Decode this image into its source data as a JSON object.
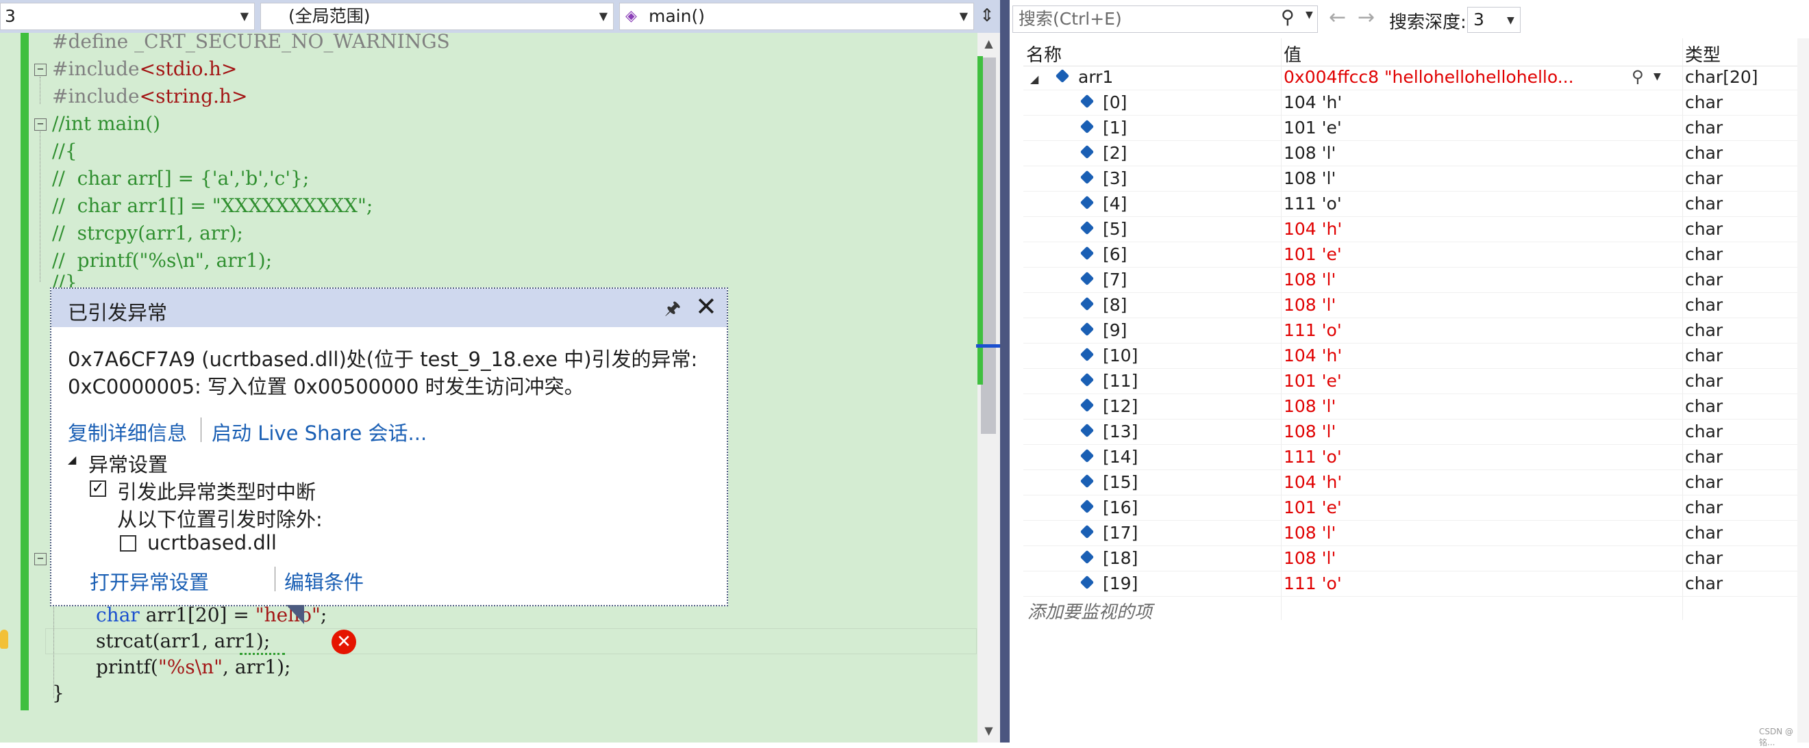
{
  "editor": {
    "nav": {
      "project_combo": "3",
      "scope_combo": "(全局范围)",
      "function_combo": "main()"
    },
    "code": {
      "l1": "#define _CRT_SECURE_NO_WARNINGS",
      "l2a": "#include",
      "l2b": "<stdio.h>",
      "l3a": "#include",
      "l3b": "<string.h>",
      "l4": "//int main()",
      "l5": "//{",
      "l6": "//  char arr[] = {'a','b','c'};",
      "l7": "//  char arr1[] = \"XXXXXXXXXX\";",
      "l8": "//  strcpy(arr1, arr);",
      "l9": "//  printf(\"%s\\n\", arr1);",
      "l10": "//}",
      "l22a": "char",
      "l22b": " arr1[20] = ",
      "l22c": "\"hello\"",
      "l22d": ";",
      "l23a": "strcat(arr1, ",
      "l23b": "arr1",
      "l23c": ");",
      "l24a": "printf(",
      "l24b": "\"%s\\n\"",
      "l24c": ", arr1);",
      "l25": "}"
    },
    "exception": {
      "title": "已引发异常",
      "message_line1": "0x7A6CF7A9 (ucrtbased.dll)处(位于 test_9_18.exe 中)引发的异常:",
      "message_line2": "0xC0000005: 写入位置 0x00500000 时发生访问冲突。",
      "link_copy": "复制详细信息",
      "link_liveshare": "启动 Live Share 会话...",
      "settings_header": "异常设置",
      "break_on_type": "引发此异常类型时中断",
      "except_when": "从以下位置引发时除外:",
      "module": "ucrtbased.dll",
      "link_open_settings": "打开异常设置",
      "link_edit_conditions": "编辑条件"
    }
  },
  "watch": {
    "search_placeholder": "搜索(Ctrl+E)",
    "search_depth_label": "搜索深度:",
    "search_depth_value": "3",
    "columns": {
      "name": "名称",
      "value": "值",
      "type": "类型"
    },
    "root": {
      "name": "arr1",
      "value": "0x004ffcc8 \"hellohellohellohello...",
      "type": "char[20]"
    },
    "elements": [
      {
        "name": "[0]",
        "value": "104 'h'",
        "type": "char",
        "changed": false
      },
      {
        "name": "[1]",
        "value": "101 'e'",
        "type": "char",
        "changed": false
      },
      {
        "name": "[2]",
        "value": "108 'l'",
        "type": "char",
        "changed": false
      },
      {
        "name": "[3]",
        "value": "108 'l'",
        "type": "char",
        "changed": false
      },
      {
        "name": "[4]",
        "value": "111 'o'",
        "type": "char",
        "changed": false
      },
      {
        "name": "[5]",
        "value": "104 'h'",
        "type": "char",
        "changed": true
      },
      {
        "name": "[6]",
        "value": "101 'e'",
        "type": "char",
        "changed": true
      },
      {
        "name": "[7]",
        "value": "108 'l'",
        "type": "char",
        "changed": true
      },
      {
        "name": "[8]",
        "value": "108 'l'",
        "type": "char",
        "changed": true
      },
      {
        "name": "[9]",
        "value": "111 'o'",
        "type": "char",
        "changed": true
      },
      {
        "name": "[10]",
        "value": "104 'h'",
        "type": "char",
        "changed": true
      },
      {
        "name": "[11]",
        "value": "101 'e'",
        "type": "char",
        "changed": true
      },
      {
        "name": "[12]",
        "value": "108 'l'",
        "type": "char",
        "changed": true
      },
      {
        "name": "[13]",
        "value": "108 'l'",
        "type": "char",
        "changed": true
      },
      {
        "name": "[14]",
        "value": "111 'o'",
        "type": "char",
        "changed": true
      },
      {
        "name": "[15]",
        "value": "104 'h'",
        "type": "char",
        "changed": true
      },
      {
        "name": "[16]",
        "value": "101 'e'",
        "type": "char",
        "changed": true
      },
      {
        "name": "[17]",
        "value": "108 'l'",
        "type": "char",
        "changed": true
      },
      {
        "name": "[18]",
        "value": "108 'l'",
        "type": "char",
        "changed": true
      },
      {
        "name": "[19]",
        "value": "111 'o'",
        "type": "char",
        "changed": true
      }
    ],
    "add_watch_placeholder": "添加要监视的项"
  },
  "watermark": "CSDN @铭...",
  "colors": {
    "changed_value": "#e00000",
    "link": "#1a5fb4",
    "editor_bg": "#d4ecd2"
  }
}
